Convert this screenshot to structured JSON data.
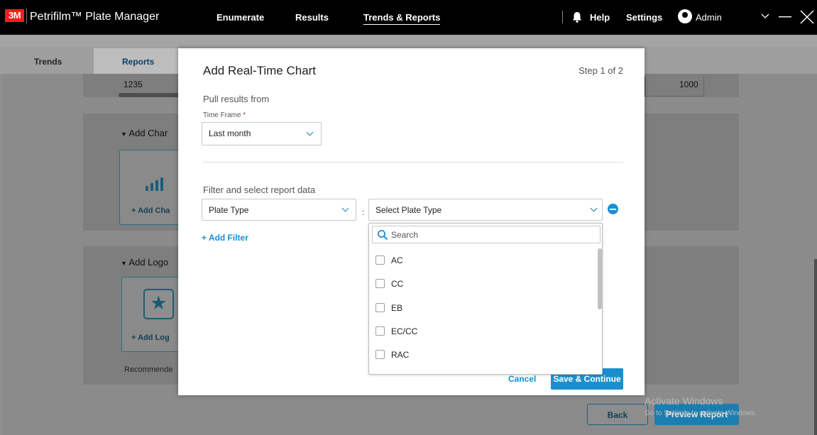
{
  "titlebar": {
    "logo": "3M",
    "app_title": "Petrifilm™ Plate Manager",
    "nav": [
      "Enumerate",
      "Results",
      "Trends & Reports"
    ],
    "help": "Help",
    "settings": "Settings",
    "user": "Admin"
  },
  "tabs": [
    "Trends",
    "Reports"
  ],
  "background": {
    "row_value_left": "1235",
    "row_value_right": "1000",
    "add_chart_heading": "Add Char",
    "add_chart_button": "+ Add Cha",
    "add_logo_heading": "Add Logo",
    "add_logo_button": "+ Add Log",
    "recommended": "Recommende",
    "back_button": "Back",
    "preview_button": "Preview Report",
    "watermark_title": "Activate Windows",
    "watermark_sub": "Go to Settings to activate Windows."
  },
  "modal": {
    "title": "Add Real-Time Chart",
    "step": "Step 1 of 2",
    "pull_results": "Pull results from",
    "time_frame_label": "Time Frame",
    "required_mark": "*",
    "time_frame_value": "Last month",
    "filter_heading": "Filter and select report data",
    "filter_field": "Plate Type",
    "filter_value_placeholder": "Select Plate Type",
    "add_filter": "+ Add Filter",
    "cancel": "Cancel",
    "save_continue": "Save & Continue"
  },
  "dropdown": {
    "search_placeholder": "Search",
    "options": [
      "AC",
      "CC",
      "EB",
      "EC/CC",
      "RAC"
    ]
  },
  "colors": {
    "accent": "#1a8fd0",
    "brand_red": "#ff1a1a",
    "overlay": "#8f8f8f"
  }
}
